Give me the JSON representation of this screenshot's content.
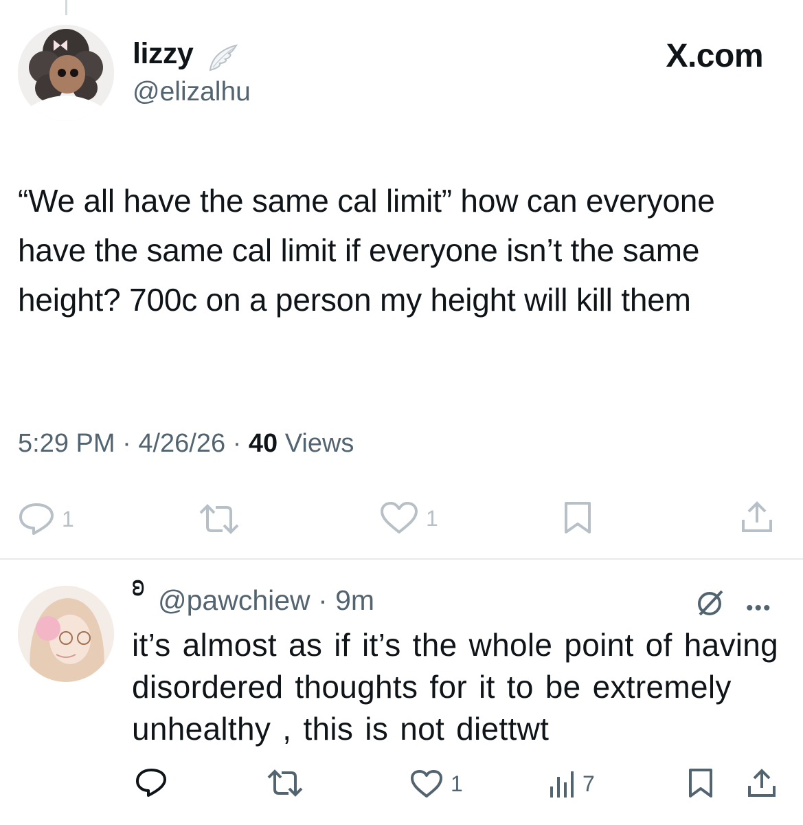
{
  "post": {
    "author_name": "lizzy",
    "author_handle": "@elizalhu",
    "site_label": "X.com",
    "text": "“We all have the same cal limit” how can everyone have the same cal limit if everyone isn’t the same height? 700c on a person my height will kill them",
    "time": "5:29 PM",
    "separator": "·",
    "date": "4/26/26",
    "views_count": "40",
    "views_label": "Views",
    "reply_count": "1",
    "like_count": "1"
  },
  "reply": {
    "badge": "ɷ",
    "handle": "@pawchiew",
    "separator": "·",
    "time": "9m",
    "more": "•••",
    "text": "it’s almost as if it’s the whole point of having disordered thoughts for it to be extremely unhealthy , this is not diettwt",
    "like_count": "1",
    "views_count": "7"
  },
  "icons": {
    "post_actions": [
      "reply-icon",
      "repost-icon",
      "like-icon",
      "bookmark-icon",
      "share-icon"
    ],
    "reply_actions": [
      "reply-icon",
      "repost-icon",
      "like-icon",
      "views-icon",
      "bookmark-icon",
      "share-icon"
    ],
    "header": [
      "wing-icon",
      "grok-icon",
      "more-icon"
    ]
  },
  "colors": {
    "text": "#0f1419",
    "secondary": "#536471",
    "faded_icons": "#b7c0c7",
    "divider": "#e7e9ea"
  }
}
